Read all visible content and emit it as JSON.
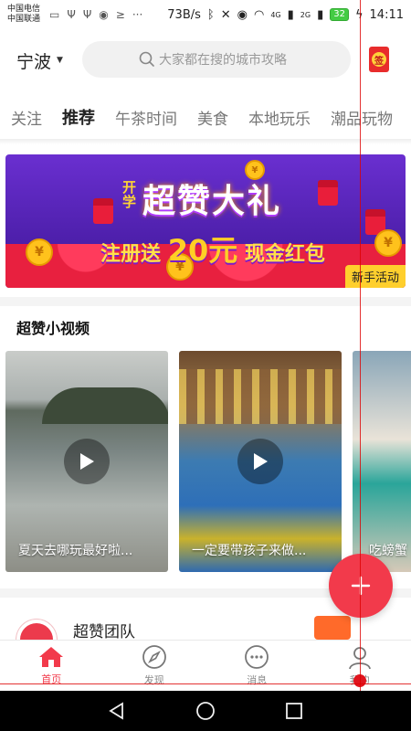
{
  "status_bar": {
    "carrier_1": "中国电信",
    "carrier_2": "中国联通",
    "speed": "73B/s",
    "net_1": "4G",
    "net_2": "2G",
    "battery": "32",
    "time": "14:11"
  },
  "header": {
    "city": "宁波",
    "search_placeholder": "大家都在搜的城市攻略",
    "signin_icon_text": "签"
  },
  "tabs": [
    {
      "label": "关注",
      "active": false
    },
    {
      "label": "推荐",
      "active": true
    },
    {
      "label": "午茶时间",
      "active": false
    },
    {
      "label": "美食",
      "active": false
    },
    {
      "label": "本地玩乐",
      "active": false
    },
    {
      "label": "潮品玩物",
      "active": false
    }
  ],
  "banner": {
    "corner": "开学",
    "title": "超赞大礼",
    "sub_prefix": "注册送",
    "sub_amount": "20元",
    "sub_suffix": "现金红包",
    "tag": "新手活动",
    "coin_symbol": "¥"
  },
  "videos_section": {
    "title": "超赞小视频",
    "items": [
      {
        "caption": "夏天去哪玩最好啦..."
      },
      {
        "caption": "一定要带孩子来做..."
      },
      {
        "caption": "吃螃蟹"
      }
    ]
  },
  "team": {
    "name": "超赞团队"
  },
  "bottom_nav": [
    {
      "label": "首页",
      "icon": "home-icon",
      "active": true
    },
    {
      "label": "发现",
      "icon": "compass-icon",
      "active": false
    },
    {
      "label": "消息",
      "icon": "message-icon",
      "active": false
    },
    {
      "label": "我的",
      "icon": "profile-icon",
      "active": false
    }
  ],
  "colors": {
    "accent": "#f23a4b",
    "tag_yellow": "#ffcf2d"
  }
}
